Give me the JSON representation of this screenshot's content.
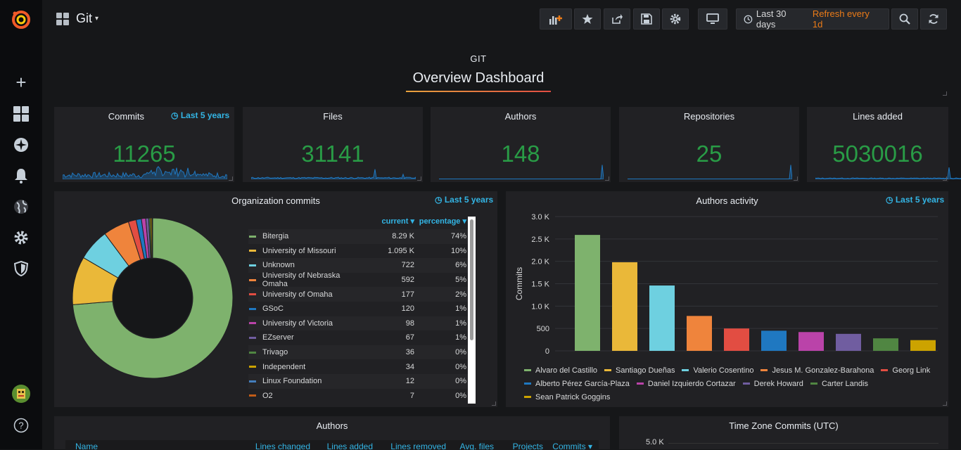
{
  "topbar": {
    "dashboard_title": "Git",
    "time_range": "Last 30 days",
    "refresh": "Refresh every 1d",
    "buttons": [
      "add-panel-icon",
      "star-icon",
      "share-icon",
      "save-icon",
      "settings-icon",
      "tv-mode-icon",
      "zoom-out-icon",
      "refresh-icon"
    ]
  },
  "heading": {
    "small": "GIT",
    "big": "Overview Dashboard"
  },
  "stats": [
    {
      "title": "Commits",
      "value": "11265",
      "info": "Last 5 years"
    },
    {
      "title": "Files",
      "value": "31141"
    },
    {
      "title": "Authors",
      "value": "148"
    },
    {
      "title": "Repositories",
      "value": "25"
    },
    {
      "title": "Lines added",
      "value": "5030016"
    }
  ],
  "org_panel": {
    "title": "Organization commits",
    "info": "Last 5 years",
    "col_current": "current",
    "col_percentage": "percentage",
    "rows": [
      {
        "name": "Bitergia",
        "current": "8.29 K",
        "pct": "74%",
        "color": "#7eb26d"
      },
      {
        "name": "University of Missouri",
        "current": "1.095 K",
        "pct": "10%",
        "color": "#eab839"
      },
      {
        "name": "Unknown",
        "current": "722",
        "pct": "6%",
        "color": "#6ed0e0"
      },
      {
        "name": "University of Nebraska Omaha",
        "current": "592",
        "pct": "5%",
        "color": "#ef843c"
      },
      {
        "name": "University of Omaha",
        "current": "177",
        "pct": "2%",
        "color": "#e24d42"
      },
      {
        "name": "GSoC",
        "current": "120",
        "pct": "1%",
        "color": "#1f78c1"
      },
      {
        "name": "University of Victoria",
        "current": "98",
        "pct": "1%",
        "color": "#ba43a9"
      },
      {
        "name": "EZserver",
        "current": "67",
        "pct": "1%",
        "color": "#705da0"
      },
      {
        "name": "Trivago",
        "current": "36",
        "pct": "0%",
        "color": "#508642"
      },
      {
        "name": "Independent",
        "current": "34",
        "pct": "0%",
        "color": "#cca300"
      },
      {
        "name": "Linux Foundation",
        "current": "12",
        "pct": "0%",
        "color": "#447ebc"
      },
      {
        "name": "O2",
        "current": "7",
        "pct": "0%",
        "color": "#c15c17"
      }
    ]
  },
  "authors_activity": {
    "title": "Authors activity",
    "info": "Last 5 years"
  },
  "authors_panel": {
    "title": "Authors",
    "columns": [
      "Name",
      "Lines changed",
      "Lines added",
      "Lines removed",
      "Avg. files",
      "Projects",
      "Commits"
    ]
  },
  "timezone_panel": {
    "title": "Time Zone Commits (UTC)",
    "first_tick": "5.0 K"
  },
  "chart_data": {
    "type": "bar",
    "ylabel": "Commits",
    "ylim": [
      0,
      3000
    ],
    "yticks": [
      "0",
      "500",
      "1.0 K",
      "1.5 K",
      "2.0 K",
      "2.5 K",
      "3.0 K"
    ],
    "legend_position": "bottom",
    "series": [
      {
        "name": "Alvaro del Castillo",
        "value": 2590,
        "color": "#7eb26d"
      },
      {
        "name": "Santiago Dueñas",
        "value": 1980,
        "color": "#eab839"
      },
      {
        "name": "Valerio Cosentino",
        "value": 1460,
        "color": "#6ed0e0"
      },
      {
        "name": "Jesus M. Gonzalez-Barahona",
        "value": 780,
        "color": "#ef843c"
      },
      {
        "name": "Georg Link",
        "value": 500,
        "color": "#e24d42"
      },
      {
        "name": "Alberto Pérez García-Plaza",
        "value": 450,
        "color": "#1f78c1"
      },
      {
        "name": "Daniel Izquierdo Cortazar",
        "value": 420,
        "color": "#ba43a9"
      },
      {
        "name": "Derek Howard",
        "value": 380,
        "color": "#705da0"
      },
      {
        "name": "Carter Landis",
        "value": 280,
        "color": "#508642"
      },
      {
        "name": "Sean Patrick Goggins",
        "value": 240,
        "color": "#cca300"
      }
    ]
  }
}
